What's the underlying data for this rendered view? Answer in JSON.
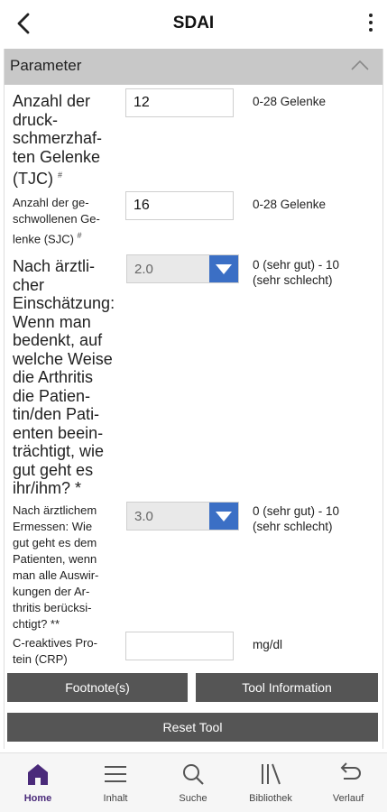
{
  "header": {
    "title": "SDAI"
  },
  "panel": {
    "title": "Parameter"
  },
  "fields": {
    "tjc": {
      "label_lines": [
        "Anzahl der",
        "druck-",
        "schmerzhaf-",
        "ten Gelenke"
      ],
      "label_last": "(TJC)",
      "footnote": "#",
      "value": "12",
      "range": "0-28 Gelenke"
    },
    "sjc": {
      "label_lines": [
        "Anzahl der ge-",
        "schwollenen Ge-"
      ],
      "label_last": "lenke (SJC)",
      "footnote": "#",
      "value": "16",
      "range": "0-28 Gelenke"
    },
    "physician": {
      "label_lines": [
        "Nach ärztli-",
        "cher",
        "Einschätzung:",
        "Wenn man",
        "bedenkt, auf",
        "welche Weise",
        "die Arthritis",
        "die Patien-",
        "tin/den Pati-",
        "enten beein-",
        "trächtigt, wie",
        "gut geht es"
      ],
      "label_last": "ihr/ihm? *",
      "selected": "2.0",
      "range": [
        "0 (sehr gut) - 10",
        "(sehr schlecht)"
      ]
    },
    "patient": {
      "label_lines": [
        "Nach ärztlichem",
        "Ermessen: Wie",
        "gut geht es dem",
        "Patienten, wenn",
        "man alle Auswir-",
        "kungen der Ar-",
        "thritis berücksi-"
      ],
      "label_last": "chtigt? **",
      "selected": "3.0",
      "range": [
        "0 (sehr gut) - 10",
        "(sehr schlecht)"
      ]
    },
    "crp": {
      "label_lines": [
        "C-reaktives Pro-",
        "tein (CRP)"
      ],
      "value": "",
      "unit": "mg/dl"
    }
  },
  "buttons": {
    "footnotes": "Footnote(s)",
    "tool_info": "Tool Information",
    "reset": "Reset Tool"
  },
  "nav": [
    {
      "label": "Home",
      "icon": "home-icon"
    },
    {
      "label": "Inhalt",
      "icon": "menu-icon"
    },
    {
      "label": "Suche",
      "icon": "search-icon"
    },
    {
      "label": "Bibliothek",
      "icon": "library-icon"
    },
    {
      "label": "Verlauf",
      "icon": "history-icon"
    }
  ],
  "colors": {
    "accent": "#3b6fc5",
    "button": "#555555",
    "nav_active": "#4a2a7a",
    "header_panel": "#c8c8c8"
  }
}
